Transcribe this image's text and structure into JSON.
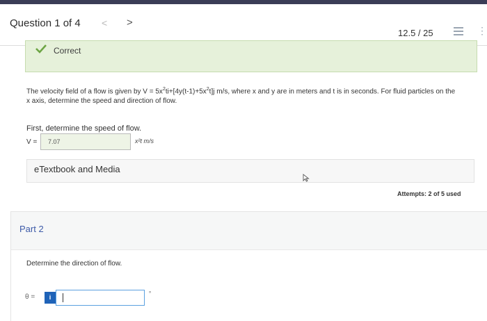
{
  "header": {
    "question_label": "Question 1 of 4",
    "prev_glyph": "<",
    "next_glyph": ">",
    "score": "12.5 / 25",
    "list_icon": "list-icon",
    "more_icon": "more-vertical-icon",
    "more_glyph": "⋮"
  },
  "status": {
    "label": "Correct",
    "icon": "checkmark-icon",
    "accent": "#6da544"
  },
  "problem": {
    "text_1": "The velocity field of a flow is given by V = 5x",
    "sup_1": "2",
    "text_2": "ti+[4y(t-1)+5x",
    "sup_2": "2",
    "text_3": "t]j m/s, where x and y are in meters and t is in seconds. For fluid particles on the x axis, determine the speed and direction of flow."
  },
  "part1": {
    "prompt": "First, determine the speed of flow.",
    "variable": "V =",
    "answer": "7.07",
    "unit": "x²t m/s"
  },
  "etextbook": {
    "label": "eTextbook and Media"
  },
  "attempts": "Attempts: 2 of 5 used",
  "part2": {
    "title": "Part 2",
    "prompt": "Determine the direction of flow.",
    "variable": "θ =",
    "info_glyph": "i",
    "unit": "°",
    "input_value": ""
  }
}
